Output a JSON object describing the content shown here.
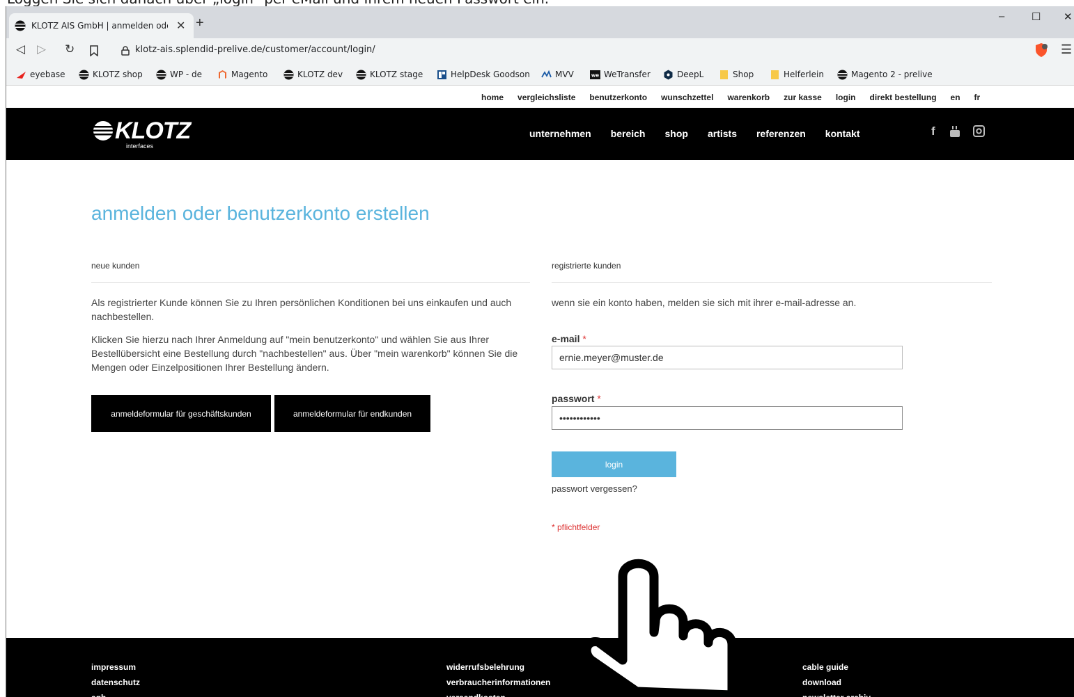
{
  "caption": "Loggen Sie sich danach über „login“ per eMail und Ihrem neuen Passwort ein.",
  "browser": {
    "tab_title": "KLOTZ AIS GmbH | anmelden oder",
    "url": "klotz-ais.splendid-prelive.de/customer/account/login/",
    "bookmarks": [
      "eyebase",
      "KLOTZ shop",
      "WP - de",
      "Magento",
      "KLOTZ dev",
      "KLOTZ stage",
      "HelpDesk Goodson",
      "MVV",
      "WeTransfer",
      "DeepL",
      "Shop",
      "Helferlein",
      "Magento 2 - prelive"
    ]
  },
  "top_links": [
    "home",
    "vergleichsliste",
    "benutzerkonto",
    "wunschzettel",
    "warenkorb",
    "zur kasse",
    "login",
    "direkt bestellung",
    "en",
    "fr"
  ],
  "logo": {
    "name": "KLOTZ",
    "tagline": "interfaces"
  },
  "main_nav": [
    "unternehmen",
    "bereich",
    "shop",
    "artists",
    "referenzen",
    "kontakt"
  ],
  "page": {
    "title": "anmelden oder benutzerkonto erstellen",
    "new_customers": {
      "heading": "neue kunden",
      "paragraph1": "Als registrierter Kunde können Sie zu Ihren persönlichen Konditionen bei uns einkaufen und auch nachbestellen.",
      "paragraph2": "Klicken Sie hierzu nach Ihrer Anmeldung auf \"mein benutzerkonto\" und wählen Sie aus Ihrer Bestellübersicht eine Bestellung durch \"nachbestellen\" aus. Über \"mein warenkorb\" können Sie die Mengen oder Einzelpositionen Ihrer Bestellung ändern.",
      "button_business": "anmeldeformular für geschäftskunden",
      "button_endcustomer": "anmeldeformular für endkunden"
    },
    "registered": {
      "heading": "registrierte kunden",
      "intro": "wenn sie ein konto haben, melden sie sich mit ihrer e-mail-adresse an.",
      "email_label": "e-mail",
      "email_value": "ernie.meyer@muster.de",
      "password_label": "passwort",
      "password_value": "••••••••••••",
      "required_mark": "*",
      "login_button": "login",
      "forgot": "passwort vergessen?",
      "required_note": "* pflichtfelder"
    }
  },
  "footer": {
    "col1": [
      "impressum",
      "datenschutz",
      "agb"
    ],
    "col2": [
      "widerrufsbelehrung",
      "verbraucherinformationen",
      "versandkosten"
    ],
    "col3": [
      "cable guide",
      "download",
      "newsletter archiv"
    ]
  },
  "colors": {
    "accent": "#5ab4dd",
    "header": "#000000",
    "required": "#dd3333"
  }
}
